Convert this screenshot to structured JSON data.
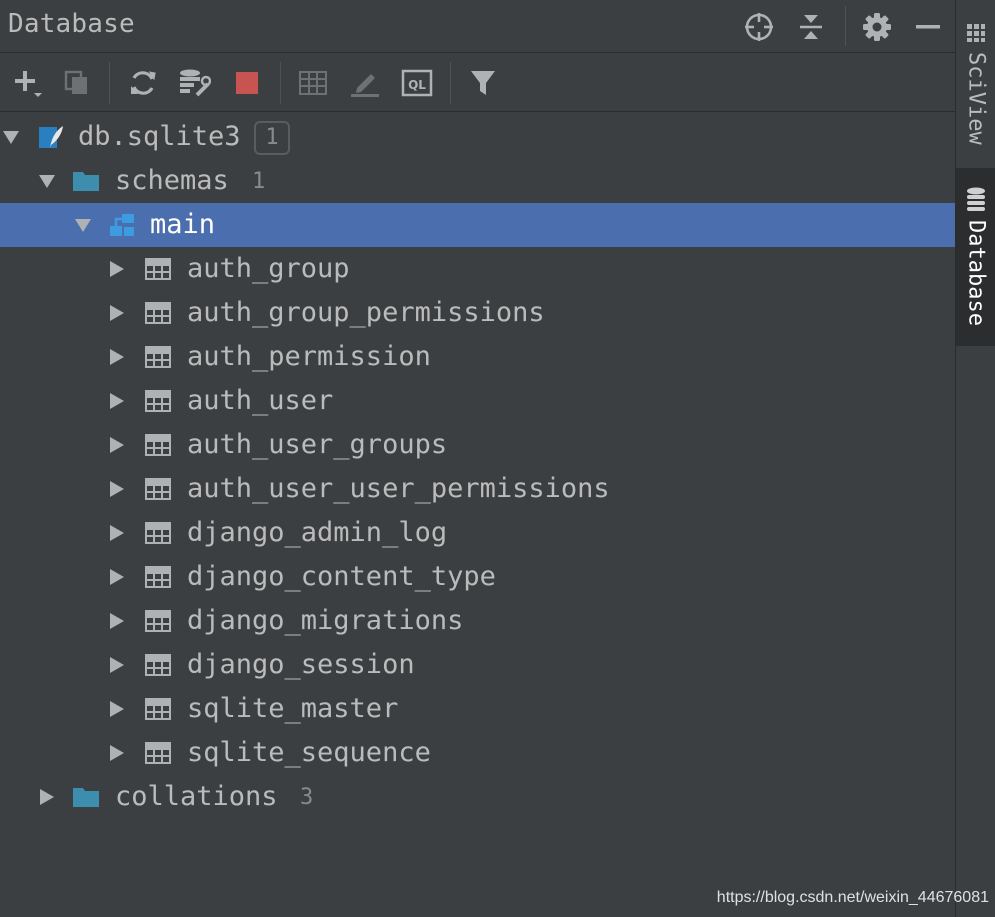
{
  "header": {
    "title": "Database",
    "icons": [
      "crosshair-icon",
      "collapse-all-icon",
      "gear-icon",
      "minimize-icon"
    ]
  },
  "toolbar": {
    "icons": [
      "add-icon",
      "duplicate-icon",
      "refresh-icon",
      "datasource-properties-icon",
      "stop-icon",
      "table-editor-icon",
      "edit-icon",
      "console-icon",
      "filter-icon"
    ],
    "console_icon_text": "QL"
  },
  "tree": {
    "root": {
      "label": "db.sqlite3",
      "count": "1"
    },
    "schemas": {
      "label": "schemas",
      "count": "1"
    },
    "main": {
      "label": "main"
    },
    "tables": [
      "auth_group",
      "auth_group_permissions",
      "auth_permission",
      "auth_user",
      "auth_user_groups",
      "auth_user_user_permissions",
      "django_admin_log",
      "django_content_type",
      "django_migrations",
      "django_session",
      "sqlite_master",
      "sqlite_sequence"
    ],
    "collations": {
      "label": "collations",
      "count": "3"
    }
  },
  "side_tabs": {
    "sciview": "SciView",
    "database": "Database"
  },
  "colors": {
    "background": "#3c3f41",
    "selection": "#4b6eaf",
    "folder": "#3d8dae",
    "stop": "#c75450",
    "sqlite": "#2a7fc0"
  },
  "watermark": "https://blog.csdn.net/weixin_44676081"
}
